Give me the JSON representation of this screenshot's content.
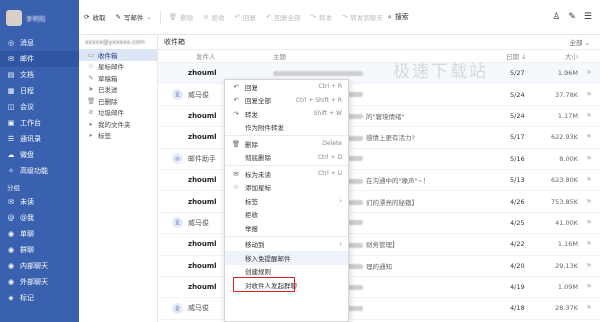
{
  "nav": {
    "username": "李明阳",
    "items": [
      {
        "icon": "message-icon",
        "glyph": "◎",
        "label": "消息"
      },
      {
        "icon": "mail-icon",
        "glyph": "✉",
        "label": "邮件"
      },
      {
        "icon": "doc-icon",
        "glyph": "▤",
        "label": "文档"
      },
      {
        "icon": "calendar-icon",
        "glyph": "▦",
        "label": "日程"
      },
      {
        "icon": "meeting-icon",
        "glyph": "◫",
        "label": "会议"
      },
      {
        "icon": "workbench-icon",
        "glyph": "▣",
        "label": "工作台"
      },
      {
        "icon": "contacts-icon",
        "glyph": "☰",
        "label": "通讯录"
      },
      {
        "icon": "cloud-icon",
        "glyph": "☁",
        "label": "微盘"
      },
      {
        "icon": "advanced-icon",
        "glyph": "✧",
        "label": "高级功能"
      }
    ],
    "group_title": "分组",
    "groups": [
      {
        "icon": "unread-icon",
        "glyph": "✉",
        "label": "未读"
      },
      {
        "icon": "mention-icon",
        "glyph": "@",
        "label": "@我"
      },
      {
        "icon": "single-chat-icon",
        "glyph": "◉",
        "label": "单聊"
      },
      {
        "icon": "group-chat-icon",
        "glyph": "◉",
        "label": "群聊"
      },
      {
        "icon": "internal-chat-icon",
        "glyph": "◉",
        "label": "内部聊天"
      },
      {
        "icon": "external-chat-icon",
        "glyph": "◉",
        "label": "外部聊天"
      },
      {
        "icon": "tag-icon",
        "glyph": "◈",
        "label": "标记"
      }
    ]
  },
  "toolbar": {
    "refresh": "收取",
    "compose": "写邮件",
    "delete": "删除",
    "reject": "拒收",
    "reply": "回复",
    "reply_all": "回复全部",
    "forward": "转发",
    "forward_to_chat": "转发到聊天",
    "search": "搜索"
  },
  "folders": {
    "account": "xxxxx@yxxxxx.com",
    "items": [
      {
        "icon": "inbox-icon",
        "glyph": "▭",
        "label": "收件箱"
      },
      {
        "icon": "star-icon",
        "glyph": "☆",
        "label": "星标邮件"
      },
      {
        "icon": "draft-icon",
        "glyph": "✎",
        "label": "草稿箱"
      },
      {
        "icon": "sent-icon",
        "glyph": "➤",
        "label": "已发送"
      },
      {
        "icon": "deleted-icon",
        "glyph": "🗑",
        "label": "已删除"
      },
      {
        "icon": "spam-icon",
        "glyph": "⊘",
        "label": "垃圾邮件"
      },
      {
        "icon": "myfolder-icon",
        "glyph": "▸",
        "label": "我的文件夹"
      },
      {
        "icon": "label-icon",
        "glyph": "▸",
        "label": "标签"
      }
    ]
  },
  "list": {
    "title": "收件箱",
    "filter": "全部",
    "col_sender": "发件人",
    "col_subject": "主题",
    "col_date": "日期",
    "col_size": "大小",
    "rows": [
      {
        "sender": "zhouml",
        "badge": "",
        "subject": "",
        "date": "5/27",
        "size": "1.96M"
      },
      {
        "sender": "威马俊",
        "badge": "企",
        "subject": "",
        "date": "5/24",
        "size": "37.78K"
      },
      {
        "sender": "zhouml",
        "badge": "",
        "subject": "的\"窘境情绪\"",
        "date": "5/24",
        "size": "1.17M"
      },
      {
        "sender": "zhouml",
        "badge": "",
        "subject": "感情上更有活力?",
        "date": "5/17",
        "size": "622.93K"
      },
      {
        "sender": "邮件助手",
        "badge": "◎",
        "subject": "",
        "date": "5/16",
        "size": "8.00K"
      },
      {
        "sender": "zhouml",
        "badge": "",
        "subject": "在沟通中的\"噪声\"~！",
        "date": "5/13",
        "size": "623.80K"
      },
      {
        "sender": "zhouml",
        "badge": "",
        "subject": "们的漂亮的秘籍】",
        "date": "4/26",
        "size": "753.85K"
      },
      {
        "sender": "威马俊",
        "badge": "企",
        "subject": "",
        "date": "4/25",
        "size": "41.00K"
      },
      {
        "sender": "zhouml",
        "badge": "",
        "subject": "财务管理】",
        "date": "4/22",
        "size": "1.16M"
      },
      {
        "sender": "zhouml",
        "badge": "",
        "subject": "理的通知",
        "date": "4/20",
        "size": "29.13K"
      },
      {
        "sender": "zhouml",
        "badge": "",
        "subject": "",
        "date": "4/19",
        "size": "1.09M"
      },
      {
        "sender": "威马俊",
        "badge": "企",
        "subject": "",
        "date": "4/18",
        "size": "28.37K"
      }
    ]
  },
  "watermark": "极速下载站",
  "context_menu": {
    "items": [
      {
        "icon": "reply-icon",
        "glyph": "↶",
        "label": "回复",
        "shortcut": "Ctrl + R"
      },
      {
        "icon": "reply-all-icon",
        "glyph": "↶",
        "label": "回复全部",
        "shortcut": "Ctrl + Shift + R"
      },
      {
        "icon": "forward-icon",
        "glyph": "↷",
        "label": "转发",
        "shortcut": "Shift + W"
      },
      {
        "icon": "",
        "glyph": "",
        "label": "作为附件转发",
        "shortcut": ""
      },
      {
        "sep": true
      },
      {
        "icon": "delete-icon",
        "glyph": "🗑",
        "label": "删除",
        "shortcut": "Delete"
      },
      {
        "icon": "",
        "glyph": "",
        "label": "彻底删除",
        "shortcut": "Ctrl + D"
      },
      {
        "sep": true
      },
      {
        "icon": "unread-icon",
        "glyph": "✉",
        "label": "标为未读",
        "shortcut": "Ctrl + U"
      },
      {
        "icon": "star-icon",
        "glyph": "☆",
        "label": "添加星标",
        "shortcut": ""
      },
      {
        "icon": "",
        "glyph": "",
        "label": "标签",
        "shortcut": "",
        "arrow": true
      },
      {
        "icon": "",
        "glyph": "",
        "label": "拒收",
        "shortcut": ""
      },
      {
        "icon": "",
        "glyph": "",
        "label": "举报",
        "shortcut": ""
      },
      {
        "sep": true
      },
      {
        "icon": "",
        "glyph": "",
        "label": "移动到",
        "shortcut": "",
        "arrow": true
      },
      {
        "icon": "",
        "glyph": "",
        "label": "移入免提醒邮件",
        "shortcut": "",
        "highlight": true
      },
      {
        "icon": "",
        "glyph": "",
        "label": "创建规则",
        "shortcut": ""
      },
      {
        "icon": "",
        "glyph": "",
        "label": "对收件人发起群聊",
        "shortcut": ""
      }
    ]
  }
}
